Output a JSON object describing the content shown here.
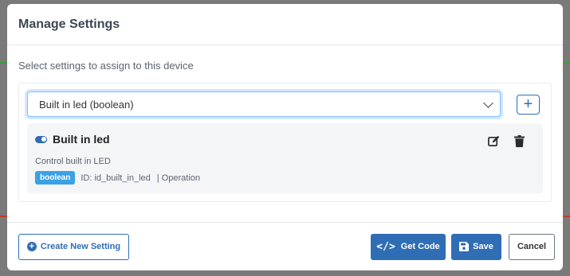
{
  "modal": {
    "title": "Manage Settings",
    "subtitle": "Select settings to assign to this device"
  },
  "select": {
    "selected": "Built in led (boolean)"
  },
  "setting": {
    "name": "Built in led",
    "description": "Control built in LED",
    "type_badge": "boolean",
    "id_text": "ID: id_built_in_led",
    "category_text": "| Operation",
    "enabled": true
  },
  "footer": {
    "create_label": "Create New Setting",
    "get_code_label": "Get Code",
    "save_label": "Save",
    "cancel_label": "Cancel"
  },
  "colors": {
    "primary": "#2f6db5",
    "badge": "#3aa1e6",
    "item_bg": "#f4f5f7"
  },
  "icons": [
    "chevron-down-icon",
    "plus-icon",
    "toggle-icon",
    "edit-icon",
    "trash-icon",
    "plus-circle-icon",
    "code-icon",
    "save-icon"
  ]
}
